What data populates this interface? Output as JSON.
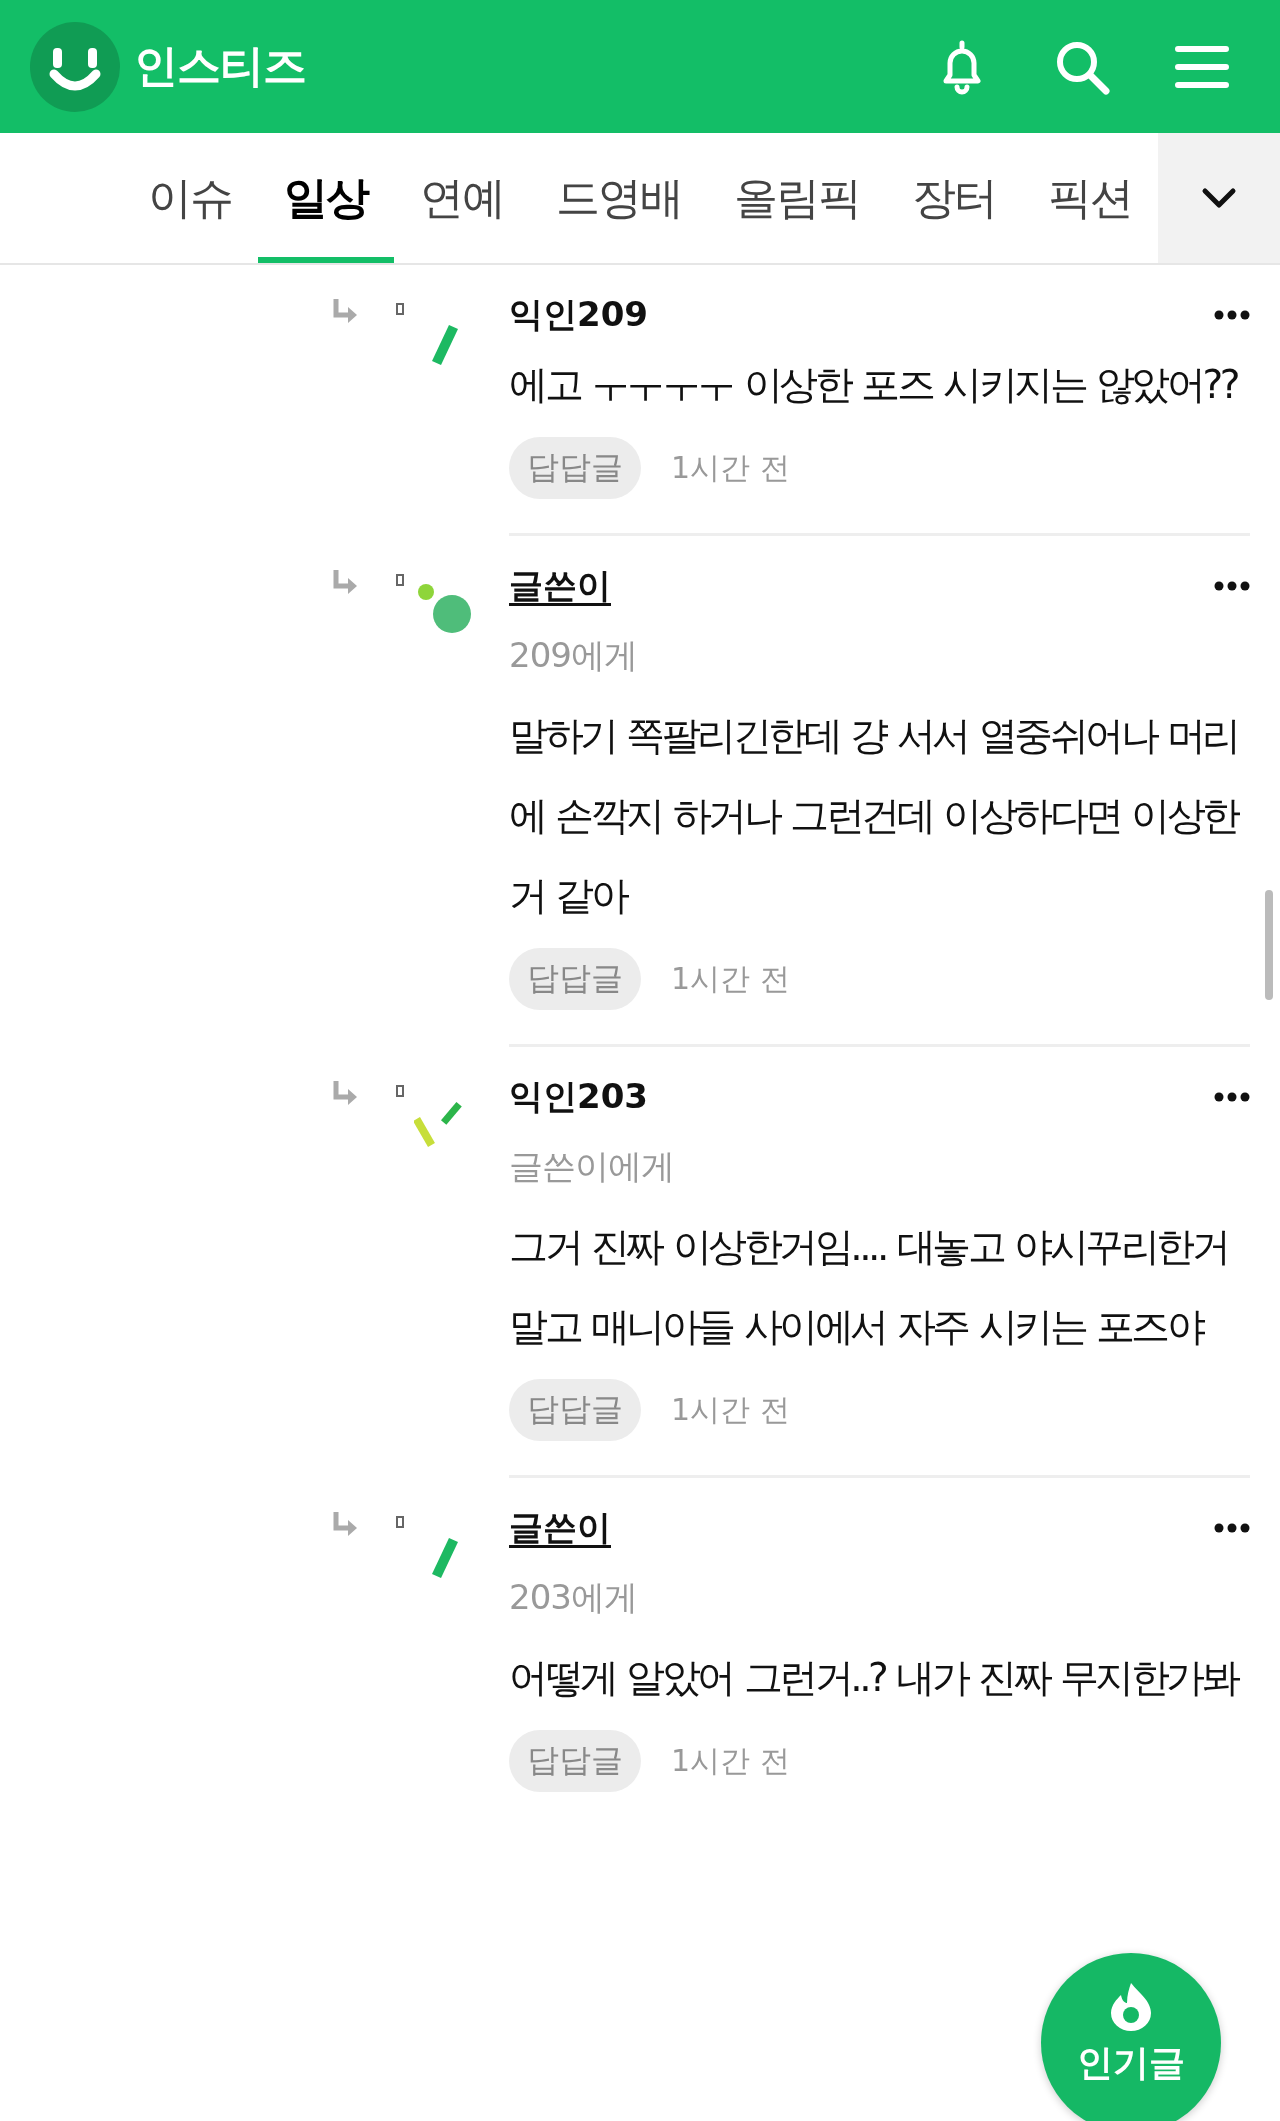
{
  "header": {
    "logo_text": "인스티즈"
  },
  "tabs": [
    {
      "label": "이슈",
      "selected": false
    },
    {
      "label": "일상",
      "selected": true
    },
    {
      "label": "연예",
      "selected": false
    },
    {
      "label": "드영배",
      "selected": false
    },
    {
      "label": "올림픽",
      "selected": false
    },
    {
      "label": "장터",
      "selected": false
    },
    {
      "label": "픽션",
      "selected": false
    }
  ],
  "comments": [
    {
      "author": "익인209",
      "is_author": false,
      "avatar": {
        "kind": "dash"
      },
      "text": "에고 ㅜㅜㅜㅜ 이상한 포즈 시키지는 않았어??",
      "reply_button": "답답글",
      "time": "1시간 전"
    },
    {
      "author": "글쓴이",
      "is_author": true,
      "avatar": {
        "kind": "dots"
      },
      "to": "209에게",
      "text": "말하기 쪽팔리긴한데 걍 서서 열중쉬어나 머리에 손깍지 하거나 그런건데 이상하다면 이상한거 같아",
      "reply_button": "답답글",
      "time": "1시간 전"
    },
    {
      "author": "익인203",
      "is_author": false,
      "avatar": {
        "kind": "strokes"
      },
      "to": "글쓴이에게",
      "text": "그거 진짜 이상한거임.... 대놓고 야시꾸리한거 말고 매니아들 사이에서 자주 시키는 포즈야",
      "reply_button": "답답글",
      "time": "1시간 전"
    },
    {
      "author": "글쓴이",
      "is_author": true,
      "avatar": {
        "kind": "dash"
      },
      "to": "203에게",
      "text": "어떻게 알았어 그런거..? 내가 진짜 무지한가봐",
      "reply_button": "답답글",
      "time": "1시간 전"
    }
  ],
  "fab": {
    "label": "인기글"
  }
}
